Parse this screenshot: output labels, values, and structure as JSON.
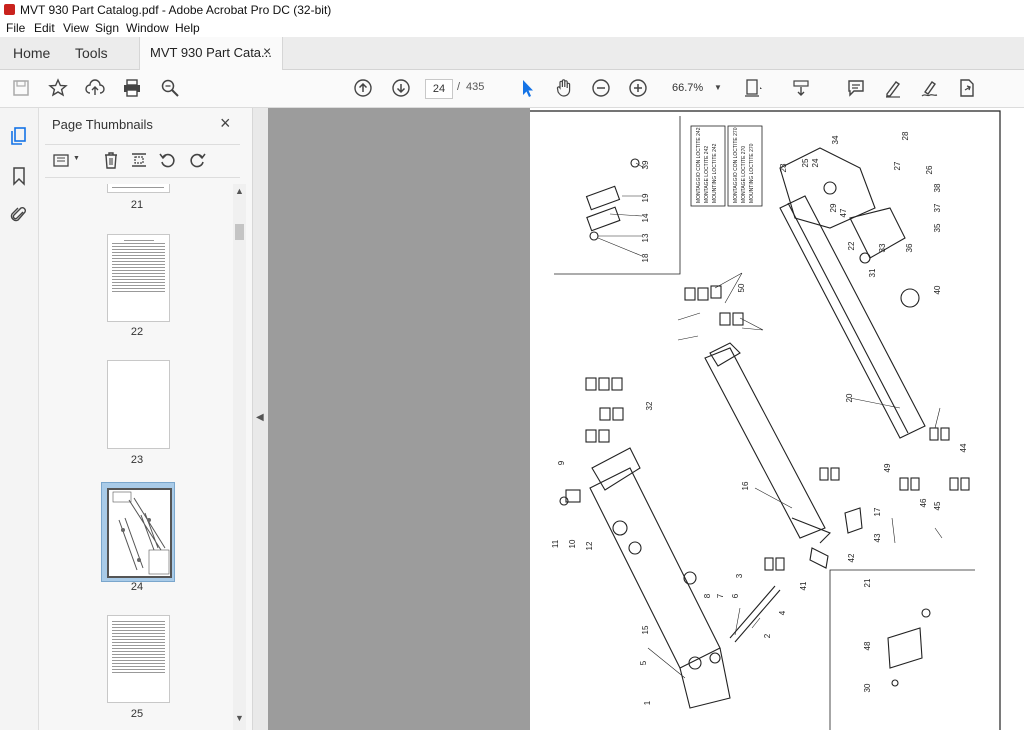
{
  "window": {
    "title": "MVT 930 Part Catalog.pdf - Adobe Acrobat Pro DC (32-bit)"
  },
  "menu": [
    "File",
    "Edit",
    "View",
    "Sign",
    "Window",
    "Help"
  ],
  "tabs": {
    "home": "Home",
    "tools": "Tools",
    "document": "MVT 930 Part Cata...",
    "close": "×"
  },
  "toolbar": {
    "current_page": "24",
    "page_separator": "/",
    "total_pages": "435",
    "zoom": "66.7%"
  },
  "panel": {
    "title": "Page Thumbnails",
    "close": "×"
  },
  "thumbnails": [
    {
      "label": "21"
    },
    {
      "label": "22"
    },
    {
      "label": "23"
    },
    {
      "label": "24",
      "selected": true
    },
    {
      "label": "25"
    }
  ],
  "document_page": {
    "box_left": {
      "lines": [
        "MONTAGGIO CON LOCTITE 242",
        "MONTAGE LOCTITE 242",
        "MOUNTING LOCTITE 242"
      ]
    },
    "box_right": {
      "lines": [
        "MONTAGGIO CON LOCTITE 270",
        "MONTAGE LOCTITE 270",
        "MOUNTING LOCTITE 270"
      ]
    },
    "callouts": [
      "39",
      "19",
      "14",
      "13",
      "18",
      "23",
      "25",
      "24",
      "34",
      "27",
      "28",
      "26",
      "29",
      "47",
      "22",
      "33",
      "31",
      "38",
      "37",
      "35",
      "36",
      "40",
      "50",
      "20",
      "49",
      "16",
      "46",
      "45",
      "44",
      "17",
      "43",
      "42",
      "41",
      "12",
      "10",
      "11",
      "32",
      "15",
      "9",
      "8",
      "7",
      "6",
      "5",
      "4",
      "3",
      "2",
      "1",
      "48",
      "21",
      "30"
    ]
  },
  "colors": {
    "accent": "#1473e6",
    "panel_bg": "#f7f7f7",
    "viewer_bg": "#9c9c9c",
    "selected_thumb": "#a9cbe8"
  }
}
